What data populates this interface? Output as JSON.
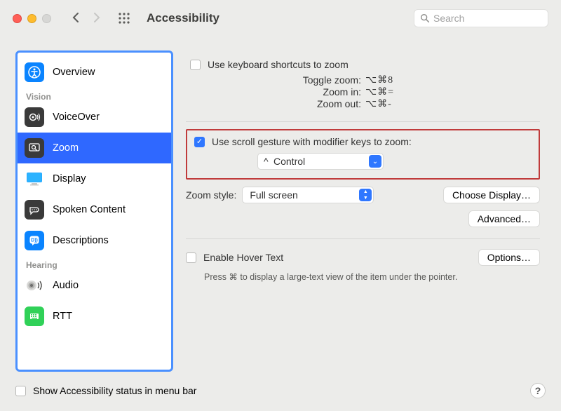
{
  "window": {
    "title": "Accessibility"
  },
  "search": {
    "placeholder": "Search"
  },
  "sidebar": {
    "sections": [
      "Vision",
      "Hearing"
    ],
    "items": [
      {
        "label": "Overview"
      },
      {
        "label": "VoiceOver"
      },
      {
        "label": "Zoom"
      },
      {
        "label": "Display"
      },
      {
        "label": "Spoken Content"
      },
      {
        "label": "Descriptions"
      },
      {
        "label": "Audio"
      },
      {
        "label": "RTT"
      }
    ]
  },
  "zoom": {
    "shortcuts_checkbox_label": "Use keyboard shortcuts to zoom",
    "shortcuts": [
      {
        "name": "Toggle zoom:",
        "keys": "⌥⌘8"
      },
      {
        "name": "Zoom in:",
        "keys": "⌥⌘="
      },
      {
        "name": "Zoom out:",
        "keys": "⌥⌘-"
      }
    ],
    "scroll_label": "Use scroll gesture with modifier keys to zoom:",
    "scroll_modifier_prefix": "^",
    "scroll_modifier": "Control",
    "style_label": "Zoom style:",
    "style_value": "Full screen",
    "choose_display_button": "Choose Display…",
    "advanced_button": "Advanced…",
    "hover_label": "Enable Hover Text",
    "hover_options_button": "Options…",
    "hover_help": "Press ⌘ to display a large-text view of the item under the pointer."
  },
  "footer": {
    "show_status_label": "Show Accessibility status in menu bar"
  }
}
